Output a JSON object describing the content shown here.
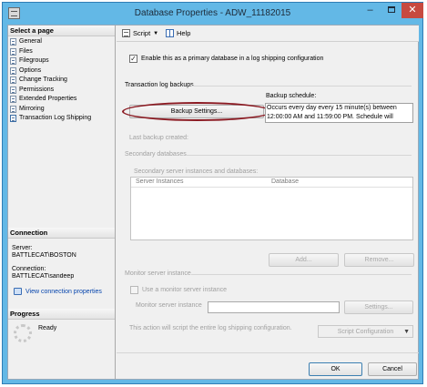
{
  "window": {
    "title": "Database Properties - ADW_11182015",
    "minimize_symbol": "–",
    "close_symbol": "✕"
  },
  "sidebar": {
    "select_page_heading": "Select a page",
    "pages": [
      {
        "label": "General",
        "icon": "page-icon"
      },
      {
        "label": "Files",
        "icon": "page-icon"
      },
      {
        "label": "Filegroups",
        "icon": "page-icon"
      },
      {
        "label": "Options",
        "icon": "page-icon"
      },
      {
        "label": "Change Tracking",
        "icon": "page-icon"
      },
      {
        "label": "Permissions",
        "icon": "page-icon"
      },
      {
        "label": "Extended Properties",
        "icon": "page-icon"
      },
      {
        "label": "Mirroring",
        "icon": "page-icon"
      },
      {
        "label": "Transaction Log Shipping",
        "icon": "page-icon"
      }
    ],
    "connection_heading": "Connection",
    "server_label": "Server:",
    "server_value": "BATTLECAT\\BOSTON",
    "connection_label": "Connection:",
    "connection_value": "BATTLECAT\\sandeep",
    "view_connection_link": "View connection properties",
    "progress_heading": "Progress",
    "progress_status": "Ready"
  },
  "toolbar": {
    "script_label": "Script",
    "help_label": "Help"
  },
  "main": {
    "enable_primary_label": "Enable this as a primary database in a log shipping configuration",
    "enable_primary_checked": true,
    "checkmark": "✓",
    "transaction_log_backups_label": "Transaction log backups",
    "backup_schedule_label": "Backup schedule:",
    "backup_settings_button": "Backup Settings...",
    "schedule_line1": "Occurs every day every 15 minute(s) between",
    "schedule_line2": "12:00:00 AM and 11:59:00 PM. Schedule will",
    "last_backup_label": "Last backup created:",
    "secondary_databases_label": "Secondary databases",
    "secondary_instances_label": "Secondary server instances and databases:",
    "columns": [
      "Server Instances",
      "Database"
    ],
    "add_button": "Add...",
    "remove_button": "Remove...",
    "monitor_instance_group_label": "Monitor server instance",
    "use_monitor_label": "Use a monitor server instance",
    "monitor_instance_field_label": "Monitor server instance",
    "settings_button": "Settings...",
    "script_note": "This action will script the entire log shipping configuration.",
    "script_configuration_button": "Script Configuration"
  },
  "footer": {
    "ok_button": "OK",
    "cancel_button": "Cancel"
  },
  "colors": {
    "title_bar": "#63b8e6",
    "close_button": "#c74a40",
    "highlight_ellipse": "#8b1a22",
    "link": "#0645ad"
  }
}
